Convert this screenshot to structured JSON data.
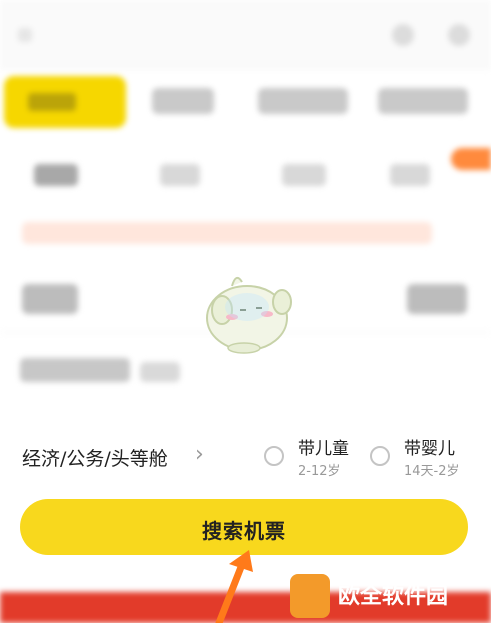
{
  "cabin_selector": {
    "label": "经济/公务/头等舱",
    "chevron": "chevron-right-icon"
  },
  "passenger_options": [
    {
      "title": "带儿童",
      "subtitle": "2-12岁",
      "checked": false
    },
    {
      "title": "带婴儿",
      "subtitle": "14天-2岁",
      "checked": false
    }
  ],
  "search_button": {
    "label": "搜索机票"
  },
  "watermark": {
    "text": "欧全软件园"
  },
  "colors": {
    "accent": "#f8d81d",
    "annotation_arrow": "#ff7a1a",
    "banner": "#e23b2a"
  }
}
